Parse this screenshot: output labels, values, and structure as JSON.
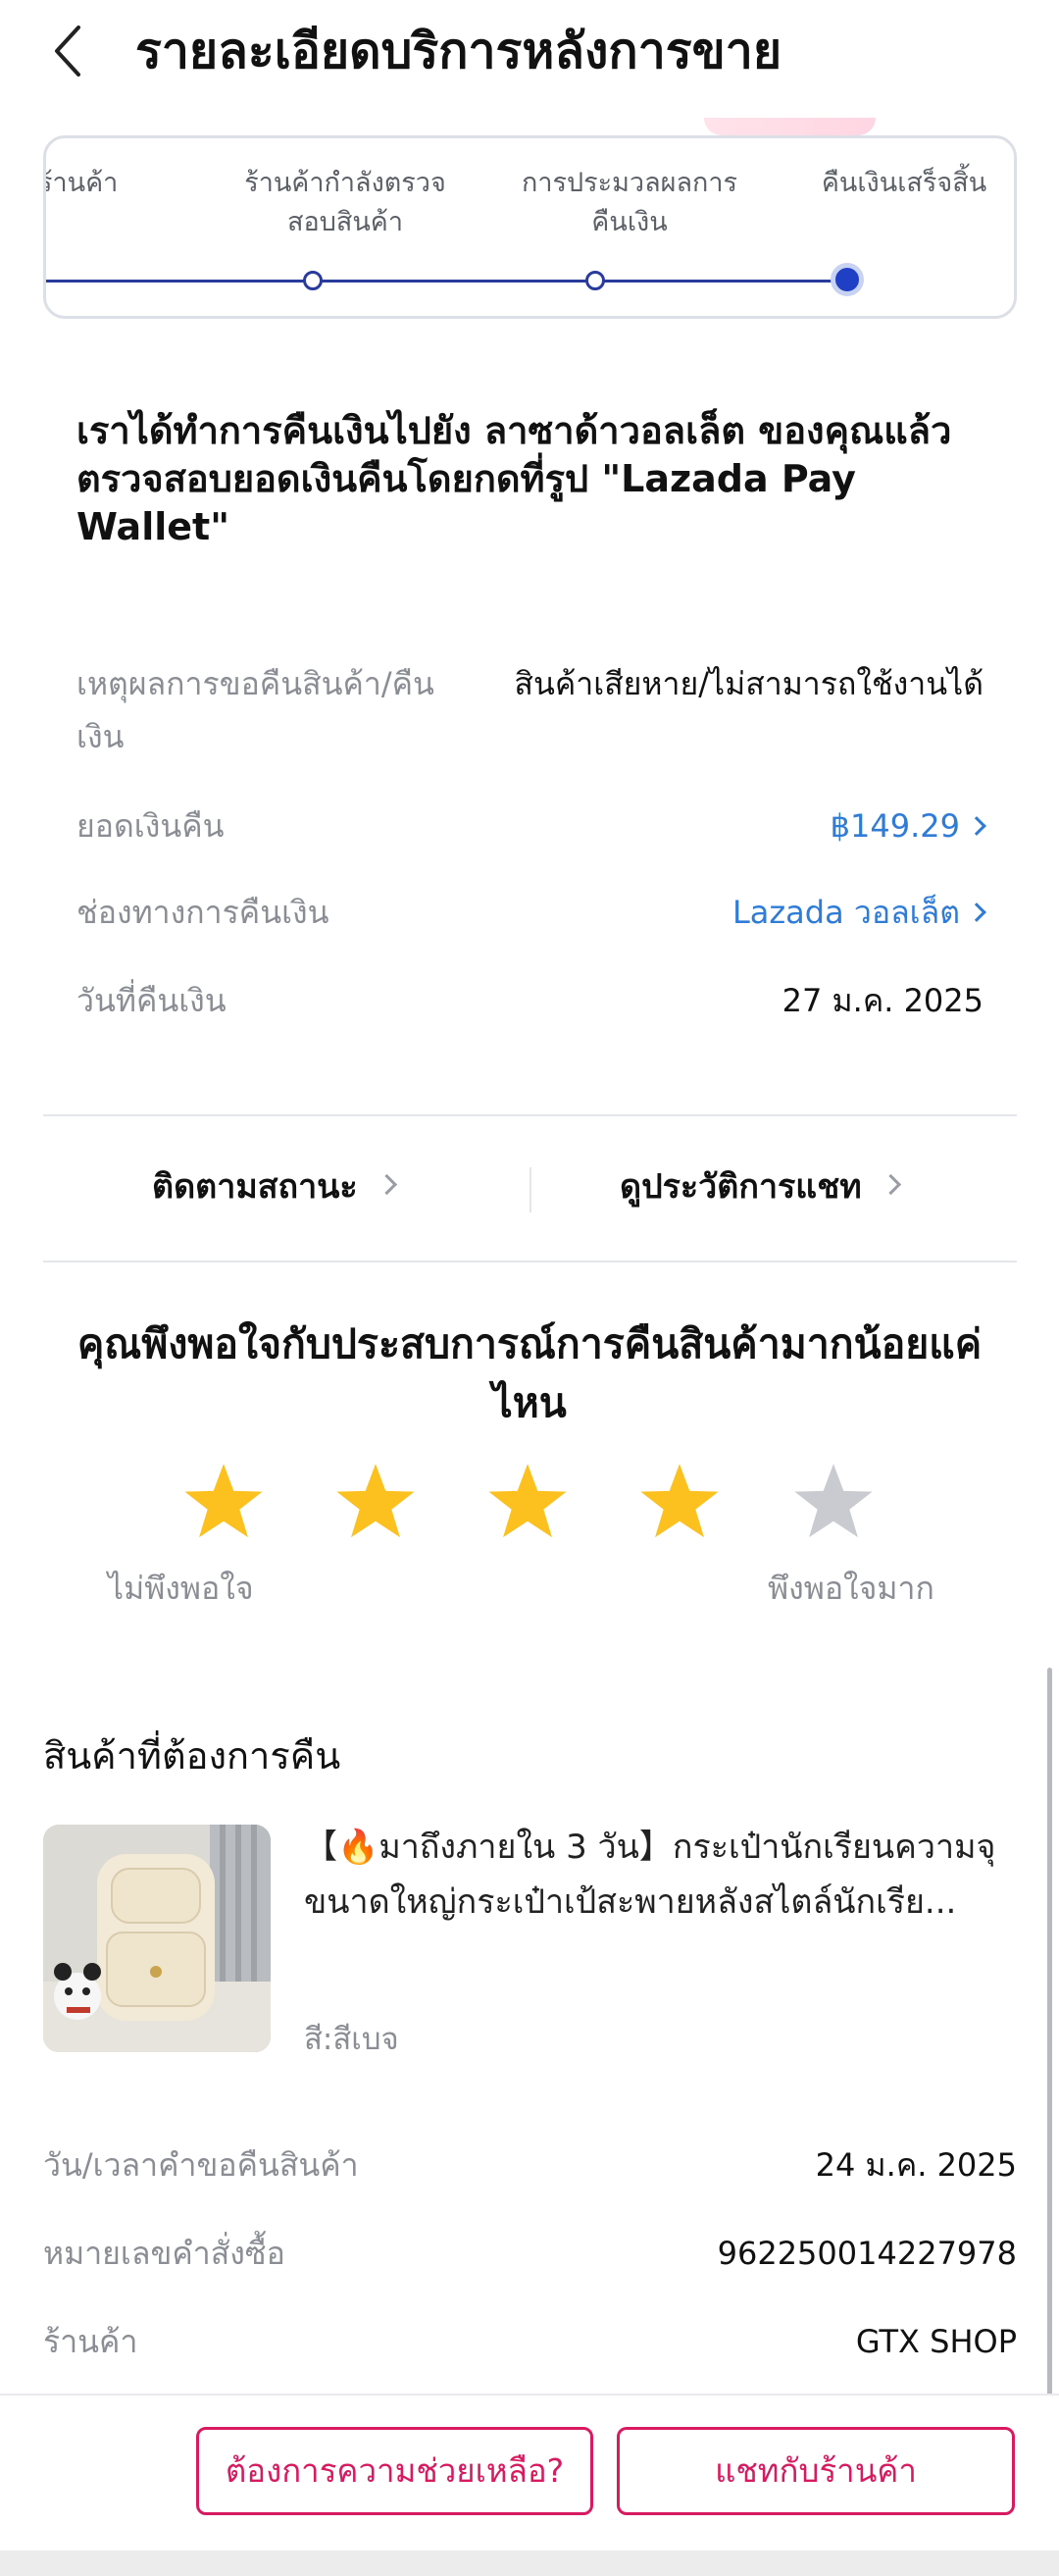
{
  "header": {
    "title": "รายละเอียดบริการหลังการขาย",
    "back_icon": "chevron-left-icon"
  },
  "progress": {
    "steps": [
      {
        "label": "ร้านค้า"
      },
      {
        "label": "ร้านค้ากำลังตรวจ\nสอบสินค้า"
      },
      {
        "label": "การประมวลผลการ\nคืนเงิน"
      },
      {
        "label": "คืนเงินเสร็จสิ้น"
      }
    ],
    "active_step": 4,
    "colors": {
      "line": "#2a3b9e",
      "active_dot": "#1f3fc5"
    }
  },
  "notice": "เราได้ทำการคืนเงินไปยัง ลาซาด้าวอลเล็ต ของคุณแล้ว ตรวจสอบยอดเงินคืนโดยกดที่รูป \"Lazada Pay Wallet\"",
  "refund_info": [
    {
      "label": "เหตุผลการขอคืนสินค้า/คืน\nเงิน",
      "value": "สินค้าเสียหาย/ไม่สามารถใช้งานได้",
      "link": false
    },
    {
      "label": "ยอดเงินคืน",
      "value": "฿149.29",
      "link": true
    },
    {
      "label": "ช่องทางการคืนเงิน",
      "value": "Lazada วอลเล็ต",
      "link": true
    },
    {
      "label": "วันที่คืนเงิน",
      "value": "27 ม.ค. 2025",
      "link": false
    }
  ],
  "actions": {
    "track_status": "ติดตามสถานะ",
    "chat_history": "ดูประวัติการแชท"
  },
  "rating": {
    "question": "คุณพึงพอใจกับประสบการณ์การคืนสินค้ามากน้อยแค่ไหน",
    "stars_total": 5,
    "stars_selected": 4,
    "low_label": "ไม่พึงพอใจ",
    "high_label": "พึงพอใจมาก",
    "colors": {
      "filled": "#fcc11e",
      "empty": "#c9cbd1"
    }
  },
  "product_section": {
    "title": "สินค้าที่ต้องการคืน",
    "product_title": "【🔥มาถึงภายใน 3 วัน】กระเป๋านักเรียนความจุขนาดใหญ่กระเป๋าเป้สะพายหลังสไตล์นักเรีย...",
    "variant": "สี:สีเบจ"
  },
  "order_info": [
    {
      "label": "วัน/เวลาคำขอคืนสินค้า",
      "value": "24 ม.ค. 2025"
    },
    {
      "label": "หมายเลขคำสั่งซื้อ",
      "value": "962250014227978"
    },
    {
      "label": "ร้านค้า",
      "value": "GTX SHOP"
    }
  ],
  "buttons": {
    "help": "ต้องการความช่วยเหลือ?",
    "chat_shop": "แชทกับร้านค้า"
  },
  "colors": {
    "accent": "#d81b60",
    "link": "#2f7bd8"
  }
}
